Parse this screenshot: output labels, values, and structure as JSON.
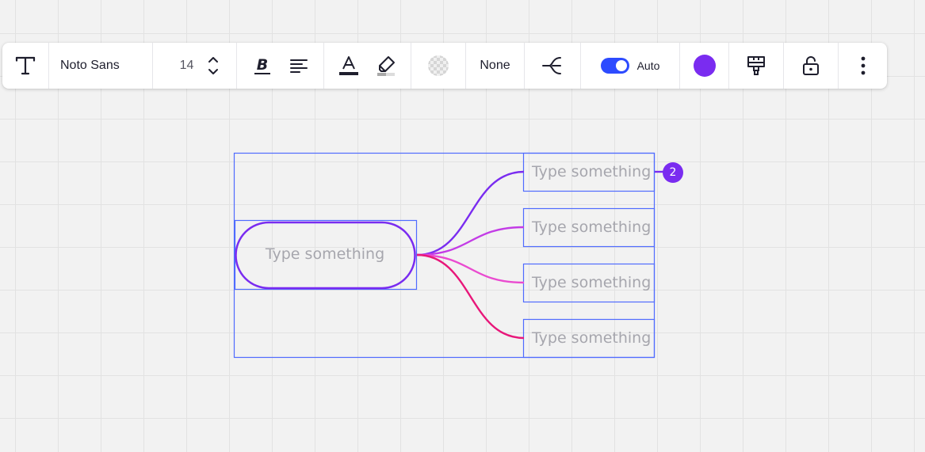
{
  "toolbar": {
    "text_icon": "text-tool-icon",
    "font_family": "Noto Sans",
    "font_size": "14",
    "none_label": "None",
    "auto_label": "Auto",
    "auto_enabled": true,
    "icons": {
      "increase": "chevron-up-icon",
      "decrease": "chevron-down-icon",
      "bold": "bold-icon",
      "align": "align-left-icon",
      "text_color": "text-color-icon",
      "highlight": "highlighter-icon",
      "fill": "transparent-fill-icon",
      "connector": "connector-style-icon",
      "style_paint": "paint-brush-icon",
      "lock": "unlock-icon",
      "more": "more-vertical-icon"
    }
  },
  "mindmap": {
    "root": {
      "text": "Type something"
    },
    "children": [
      {
        "text": "Type something"
      },
      {
        "text": "Type something"
      },
      {
        "text": "Type something"
      },
      {
        "text": "Type something"
      }
    ],
    "badge_count": "2"
  },
  "colors": {
    "accent": "#7a2cf0",
    "selection": "#4f6bff",
    "toggle": "#2d4bff",
    "branch_1": "#7a2cf0",
    "branch_2": "#c33ce6",
    "branch_3": "#ea4bd0",
    "branch_4": "#e8177a",
    "placeholder_text": "#a6a6ad"
  }
}
